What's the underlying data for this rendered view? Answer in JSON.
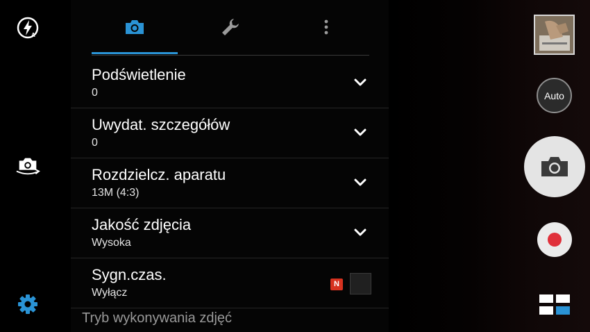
{
  "colors": {
    "accent": "#2a93d5",
    "badge_red": "#d7321f",
    "record_red": "#e0303a",
    "panel_bg": "#050505"
  },
  "left_rail": {
    "icons": [
      "flash-auto-icon",
      "switch-camera-icon",
      "settings-gear-icon"
    ]
  },
  "tabs": [
    {
      "icon": "camera-icon",
      "active": true
    },
    {
      "icon": "wrench-icon",
      "active": false
    },
    {
      "icon": "more-vert-icon",
      "active": false
    }
  ],
  "settings": [
    {
      "label": "Podświetlenie",
      "value": "0"
    },
    {
      "label": "Uwydat. szczegółów",
      "value": "0"
    },
    {
      "label": "Rozdzielcz. aparatu",
      "value": "13M (4:3)"
    },
    {
      "label": "Jakość zdjęcia",
      "value": "Wysoka"
    },
    {
      "label": "Sygn.czas.",
      "value": "Wyłącz",
      "badge": "N",
      "checked": false
    }
  ],
  "cut_off_row": "Tryb wykonywania zdjęć",
  "right_controls": {
    "auto_label": "Auto",
    "shutter_icon": "camera-icon",
    "record_icon": "record-icon",
    "mode_icon": "mode-grid-icon"
  }
}
